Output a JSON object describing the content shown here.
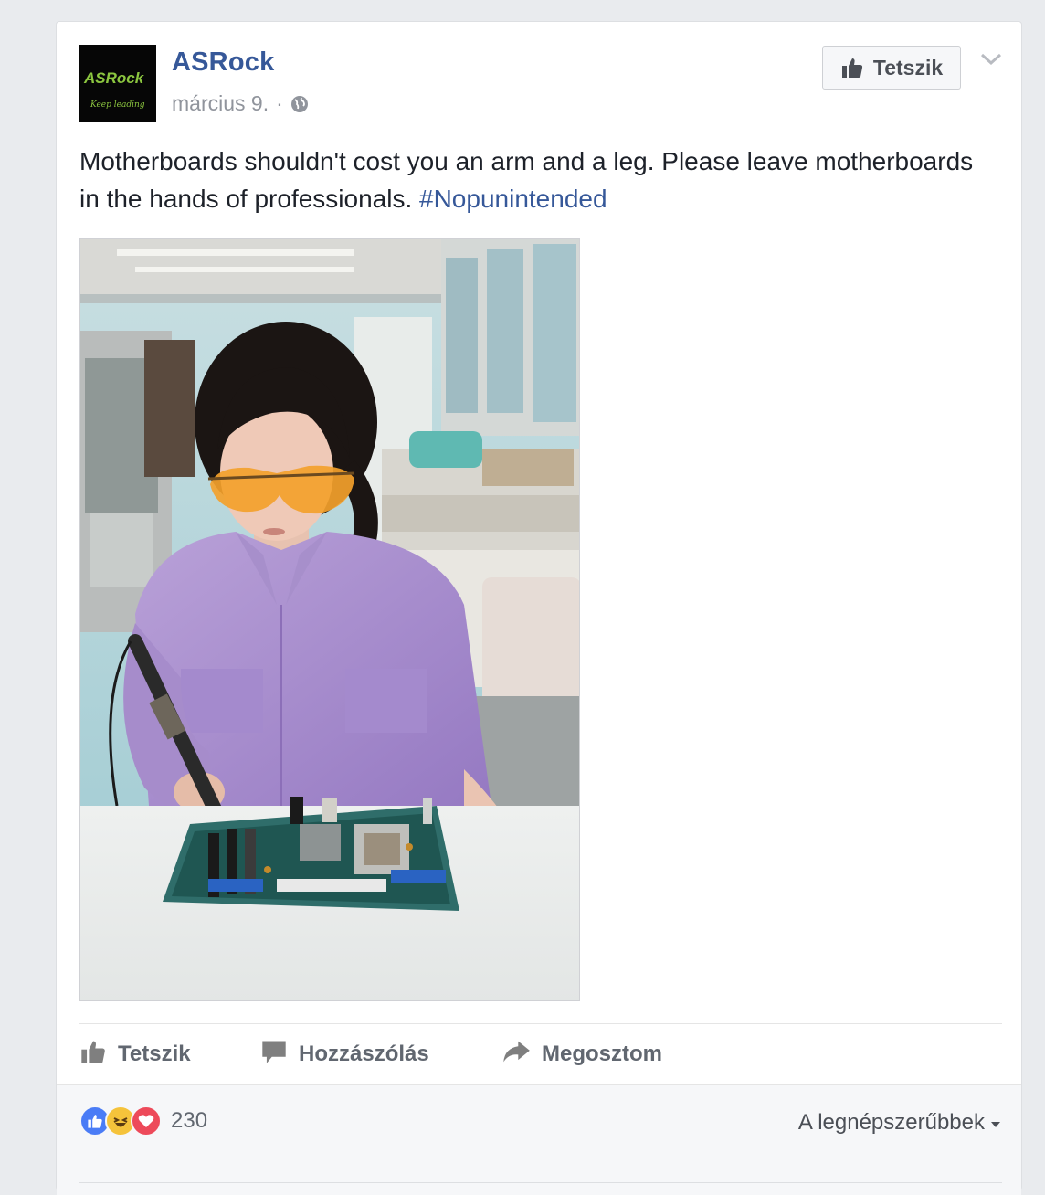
{
  "post": {
    "page_name": "ASRock",
    "avatar": {
      "logo_text": "ASRock",
      "tagline": "Keep leading",
      "logo_color": "#8bc53f"
    },
    "date": "március 9.",
    "separator": "·",
    "privacy_icon": "globe-icon",
    "like_page_button": "Tetszik",
    "text": "Motherboards shouldn't cost you an arm and a leg. Please leave motherboards in the hands of professionals. ",
    "hashtag": "#Nopunintended",
    "photo_alt": "Woman in purple shirt and orange safety glasses soldering a motherboard in a lab"
  },
  "actions": {
    "like": "Tetszik",
    "comment": "Hozzászólás",
    "share": "Megosztom"
  },
  "footer": {
    "reactions": [
      "like-reaction-icon",
      "haha-reaction-icon",
      "love-reaction-icon"
    ],
    "reaction_count": "230",
    "sort_label": "A legnépszerűbbek"
  },
  "colors": {
    "link": "#365899",
    "text": "#1d2129",
    "muted": "#90949c",
    "like_blue": "#4a7cf6",
    "love_red": "#ed4a5a",
    "haha_yellow": "#f5c33b"
  }
}
